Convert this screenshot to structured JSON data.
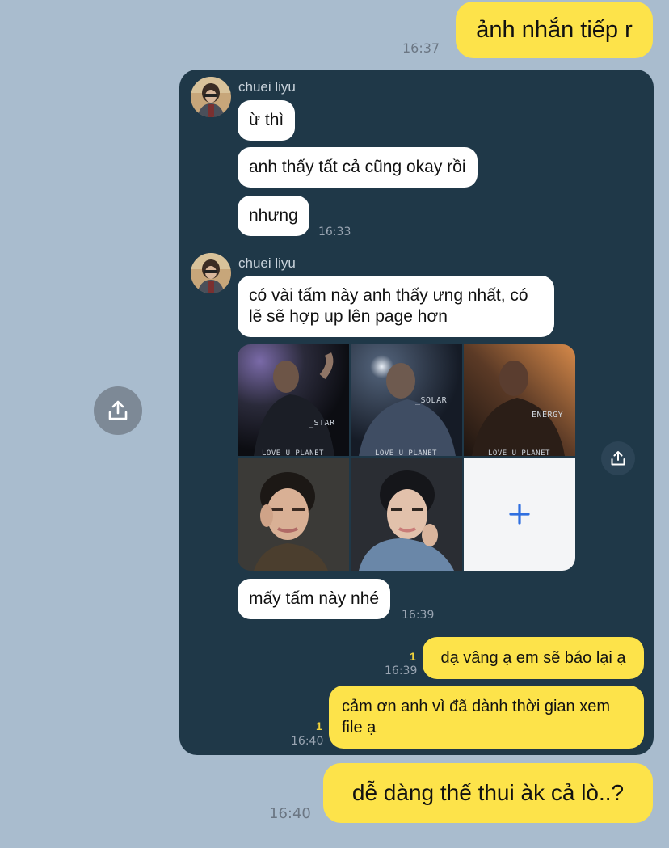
{
  "messages_top": {
    "sent_1": {
      "text": "ảnh nhắn tiếp r",
      "time": "16:37"
    }
  },
  "forwarded": {
    "group1": {
      "sender": "chuei liyu",
      "bubbles": [
        "ừ thì",
        "anh thấy tất cả cũng okay rồi",
        "nhưng"
      ],
      "time": "16:33"
    },
    "group2": {
      "sender": "chuei liyu",
      "text": "có vài tấm này anh thấy ưng nhất, có lẽ sẽ hợp up lên page hơn",
      "photo_captions": [
        "_STAR",
        "_SOLAR",
        "ENERGY"
      ],
      "caption_text": "LOVE U PLANET",
      "after_text": "mấy tấm này nhé",
      "after_time": "16:39"
    },
    "reply1": {
      "text": "dạ vâng ạ em sẽ báo lại ạ",
      "read": "1",
      "time": "16:39"
    },
    "reply2": {
      "text": "cảm ơn anh vì đã dành thời gian xem file ạ",
      "read": "1",
      "time": "16:40"
    }
  },
  "messages_bottom": {
    "sent_2": {
      "text": "dễ dàng thế thui àk cả lò..?",
      "time": "16:40"
    }
  },
  "icons": {
    "share_outer": "share-icon",
    "share_inner": "share-icon",
    "plus": "plus-icon"
  },
  "colors": {
    "background": "#a9bcce",
    "sent_bubble": "#fde34a",
    "panel": "#1f3848",
    "received_bubble": "#ffffff",
    "plus": "#2f6fe0"
  }
}
